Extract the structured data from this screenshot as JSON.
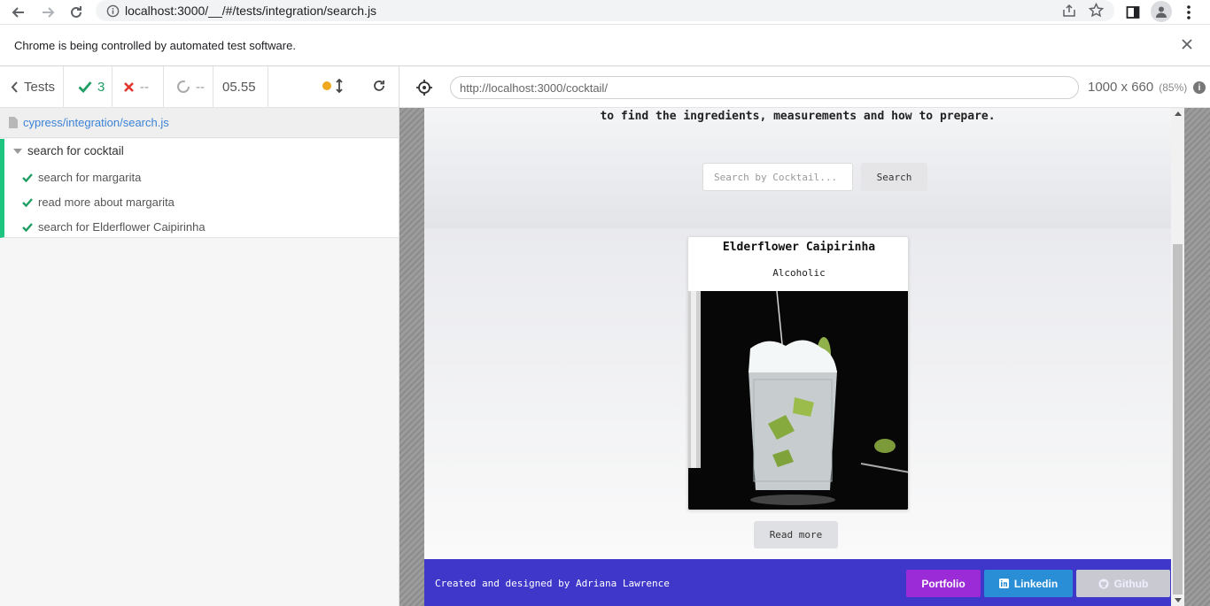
{
  "browser": {
    "url": "localhost:3000/__/#/tests/integration/search.js"
  },
  "infobar": {
    "message": "Chrome is being controlled by automated test software."
  },
  "reporter": {
    "tests_label": "Tests",
    "passed": "3",
    "failed": "--",
    "pending": "--",
    "duration": "05.55",
    "spec_path": "cypress/integration/search.js",
    "suite": "search for cocktail",
    "tests": [
      "search for margarita",
      "read more about margarita",
      "search for Elderflower Caipirinha"
    ]
  },
  "aut": {
    "url": "http://localhost:3000/cocktail/",
    "viewport": "1000 x 660",
    "scale": "(85%)"
  },
  "app": {
    "hero_text": "to find the ingredients, measurements and how to prepare.",
    "search_placeholder": "Search by Cocktail...",
    "search_button": "Search",
    "card": {
      "title": "Elderflower Caipirinha",
      "category": "Alcoholic"
    },
    "read_more": "Read more",
    "footer": {
      "credit": "Created and designed by Adriana Lawrence",
      "portfolio": "Portfolio",
      "linkedin": "Linkedin",
      "github": "Github"
    }
  },
  "colors": {
    "passed": "#1f9e64",
    "failed": "#e2352d",
    "footer_bg": "#3f37c9",
    "portfolio": "#9b2bd6",
    "linkedin": "#2a8ed6",
    "github": "#c9cad1"
  }
}
